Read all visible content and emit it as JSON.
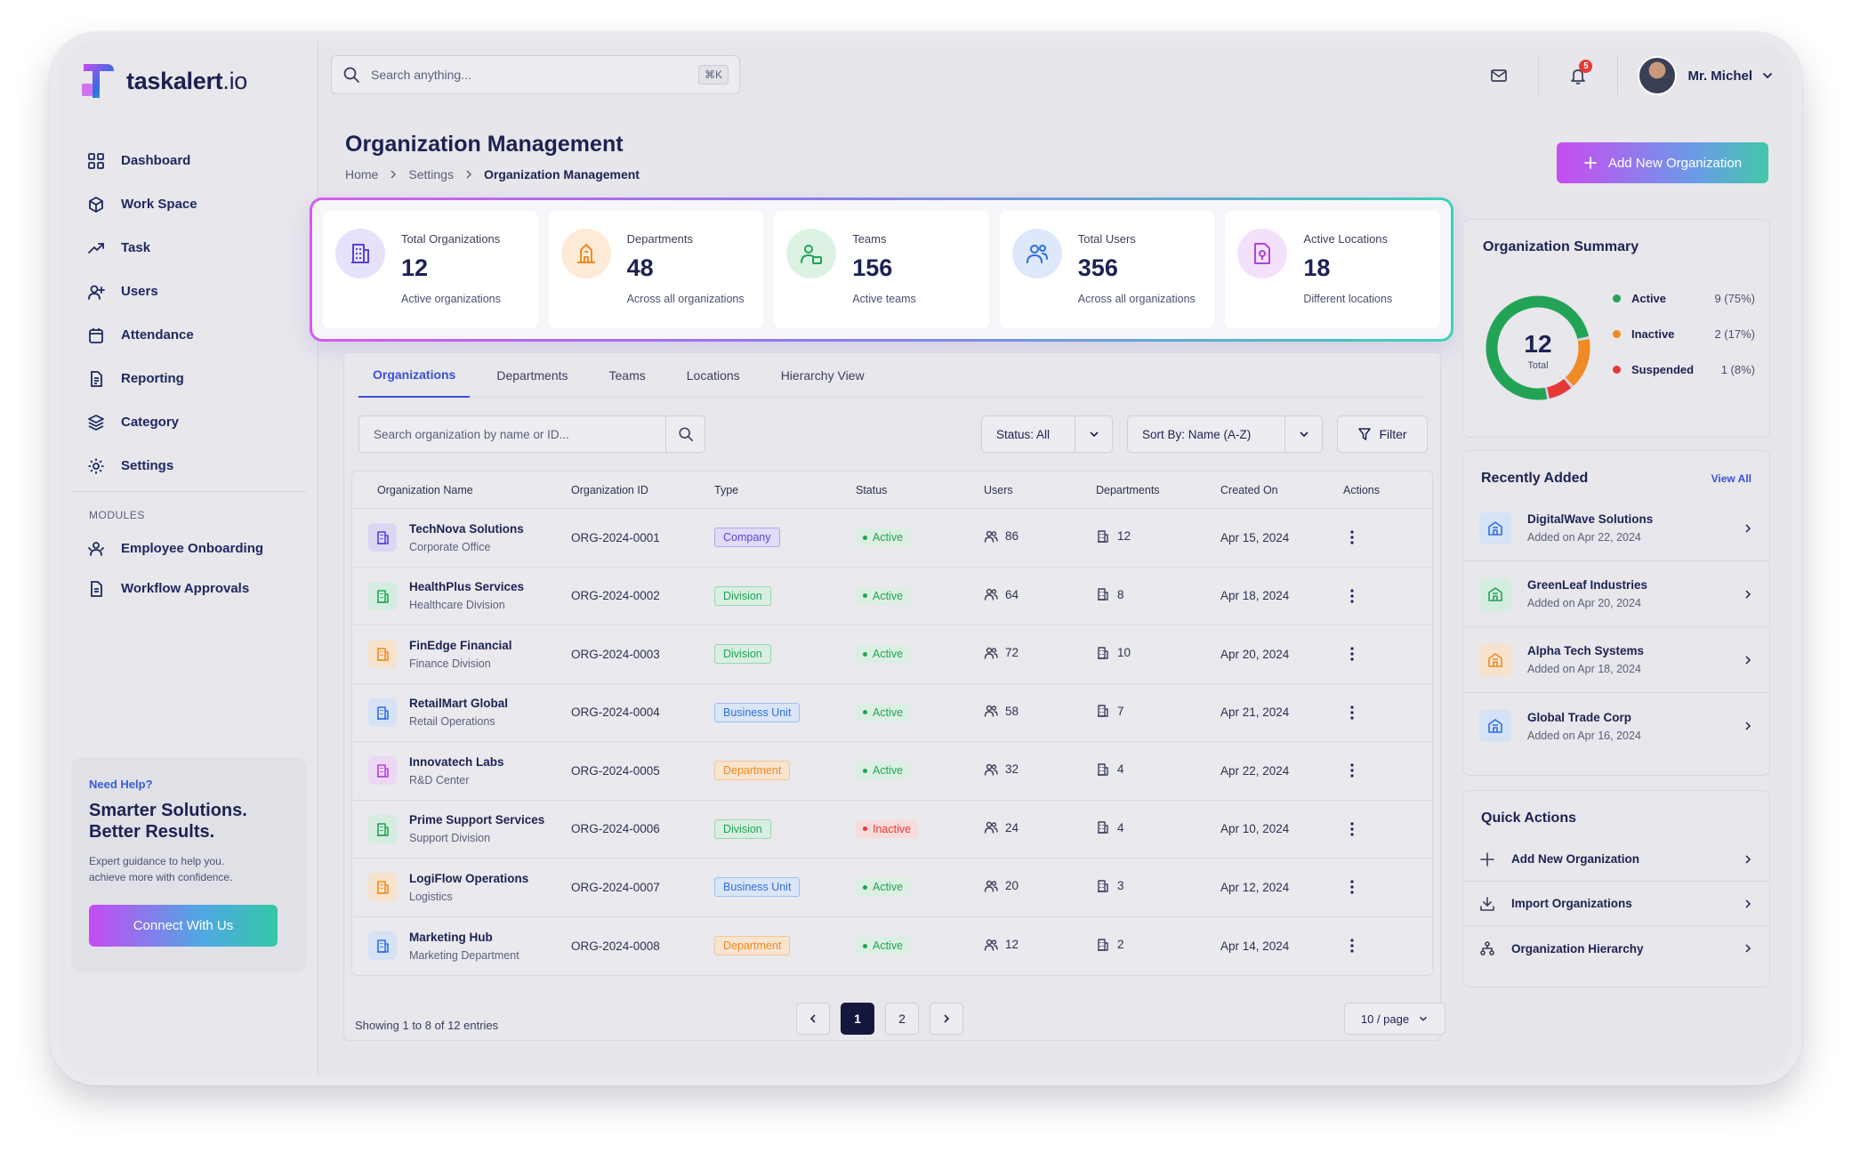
{
  "app": {
    "name": "taskalert",
    "name_suffix": ".io"
  },
  "colors": {
    "accent": "#3b4fd6",
    "active": "#22a355",
    "inactive": "#e53935",
    "suspended": "#e53935",
    "warning": "#f08a24"
  },
  "sidebar": {
    "items": [
      {
        "label": "Dashboard",
        "icon": "grid-icon"
      },
      {
        "label": "Work Space",
        "icon": "cube-icon"
      },
      {
        "label": "Task",
        "icon": "trend-icon"
      },
      {
        "label": "Users",
        "icon": "user-plus-icon"
      },
      {
        "label": "Attendance",
        "icon": "calendar-icon"
      },
      {
        "label": "Reporting",
        "icon": "document-icon"
      },
      {
        "label": "Category",
        "icon": "layers-icon"
      },
      {
        "label": "Settings",
        "icon": "gear-icon"
      }
    ],
    "modules_label": "MODULES",
    "modules": [
      {
        "label": "Employee Onboarding",
        "icon": "user-group-icon"
      },
      {
        "label": "Workflow Approvals",
        "icon": "document-check-icon"
      }
    ],
    "help": {
      "kicker": "Need Help?",
      "title_line1": "Smarter Solutions.",
      "title_line2": "Better Results.",
      "desc_line1": "Expert guidance to help you.",
      "desc_line2": "achieve more with confidence.",
      "button": "Connect With Us"
    }
  },
  "topbar": {
    "search_placeholder": "Search anything...",
    "shortcut": "⌘K",
    "notification_count": "5",
    "user_name": "Mr. Michel"
  },
  "page": {
    "title": "Organization Management",
    "breadcrumb": [
      "Home",
      "Settings",
      "Organization Management"
    ],
    "add_button": "Add New Organization"
  },
  "stats": [
    {
      "label": "Total Organizations",
      "value": "12",
      "sub": "Active organizations",
      "icon": "building-icon",
      "color": "#5b3fd9",
      "bg": "#e7e2fb"
    },
    {
      "label": "Departments",
      "value": "48",
      "sub": "Across all organizations",
      "icon": "department-icon",
      "color": "#f08a24",
      "bg": "#fdebd8"
    },
    {
      "label": "Teams",
      "value": "156",
      "sub": "Active teams",
      "icon": "team-icon",
      "color": "#22a355",
      "bg": "#dcf3e4"
    },
    {
      "label": "Total Users",
      "value": "356",
      "sub": "Across all organizations",
      "icon": "users-icon",
      "color": "#2f6fe0",
      "bg": "#dde8fb"
    },
    {
      "label": "Active Locations",
      "value": "18",
      "sub": "Different locations",
      "icon": "location-icon",
      "color": "#b043e0",
      "bg": "#f3e0fb"
    }
  ],
  "tabs": [
    "Organizations",
    "Departments",
    "Teams",
    "Locations",
    "Hierarchy View"
  ],
  "filters": {
    "search_placeholder": "Search organization by name or ID...",
    "status": "Status: All",
    "sort": "Sort By: Name (A-Z)",
    "filter_label": "Filter"
  },
  "table": {
    "columns": [
      "Organization Name",
      "Organization ID",
      "Type",
      "Status",
      "Users",
      "Departments",
      "Created On",
      "Actions"
    ],
    "rows": [
      {
        "name": "TechNova Solutions",
        "sub": "Corporate Office",
        "id": "ORG-2024-0001",
        "type": "Company",
        "status": "Active",
        "users": "86",
        "departments": "12",
        "created": "Apr 15, 2024",
        "icon_color": "#5b3fd9",
        "icon_bg": "#dcd6f5"
      },
      {
        "name": "HealthPlus Services",
        "sub": "Healthcare Division",
        "id": "ORG-2024-0002",
        "type": "Division",
        "status": "Active",
        "users": "64",
        "departments": "8",
        "created": "Apr 18, 2024",
        "icon_color": "#22a355",
        "icon_bg": "#d4ede0"
      },
      {
        "name": "FinEdge Financial",
        "sub": "Finance Division",
        "id": "ORG-2024-0003",
        "type": "Division",
        "status": "Active",
        "users": "72",
        "departments": "10",
        "created": "Apr 20, 2024",
        "icon_color": "#f08a24",
        "icon_bg": "#f7e2cc"
      },
      {
        "name": "RetailMart Global",
        "sub": "Retail Operations",
        "id": "ORG-2024-0004",
        "type": "Business Unit",
        "status": "Active",
        "users": "58",
        "departments": "7",
        "created": "Apr 21, 2024",
        "icon_color": "#2f6fe0",
        "icon_bg": "#d6e2f6"
      },
      {
        "name": "Innovatech Labs",
        "sub": "R&D Center",
        "id": "ORG-2024-0005",
        "type": "Department",
        "status": "Active",
        "users": "32",
        "departments": "4",
        "created": "Apr 22, 2024",
        "icon_color": "#b043e0",
        "icon_bg": "#ecd8f5"
      },
      {
        "name": "Prime Support Services",
        "sub": "Support Division",
        "id": "ORG-2024-0006",
        "type": "Division",
        "status": "Inactive",
        "users": "24",
        "departments": "4",
        "created": "Apr 10, 2024",
        "icon_color": "#22a355",
        "icon_bg": "#d4ede0"
      },
      {
        "name": "LogiFlow Operations",
        "sub": "Logistics",
        "id": "ORG-2024-0007",
        "type": "Business Unit",
        "status": "Active",
        "users": "20",
        "departments": "3",
        "created": "Apr 12, 2024",
        "icon_color": "#f08a24",
        "icon_bg": "#f7e2cc"
      },
      {
        "name": "Marketing Hub",
        "sub": "Marketing Department",
        "id": "ORG-2024-0008",
        "type": "Department",
        "status": "Active",
        "users": "12",
        "departments": "2",
        "created": "Apr 14, 2024",
        "icon_color": "#2f6fe0",
        "icon_bg": "#d6e2f6"
      }
    ]
  },
  "pagination": {
    "info": "Showing 1 to 8 of 12 entries",
    "pages": [
      "1",
      "2"
    ],
    "current": "1",
    "per_page": "10 / page"
  },
  "summary": {
    "title": "Organization Summary",
    "total_value": "12",
    "total_label": "Total",
    "segments": [
      {
        "name": "Active",
        "label": "9 (75%)",
        "value": 9,
        "color": "#22a355"
      },
      {
        "name": "Inactive",
        "label": "2 (17%)",
        "value": 2,
        "color": "#f08a24"
      },
      {
        "name": "Suspended",
        "label": "1 (8%)",
        "value": 1,
        "color": "#e53935"
      }
    ]
  },
  "recent": {
    "title": "Recently Added",
    "view_all": "View All",
    "items": [
      {
        "name": "DigitalWave Solutions",
        "sub": "Added on Apr 22, 2024",
        "color": "#2f6fe0",
        "bg": "#d6e2f6"
      },
      {
        "name": "GreenLeaf Industries",
        "sub": "Added on Apr 20, 2024",
        "color": "#22a355",
        "bg": "#d4ede0"
      },
      {
        "name": "Alpha Tech Systems",
        "sub": "Added on Apr 18, 2024",
        "color": "#f08a24",
        "bg": "#f7e2cc"
      },
      {
        "name": "Global Trade Corp",
        "sub": "Added on Apr 16, 2024",
        "color": "#2f6fe0",
        "bg": "#d6e2f6"
      }
    ]
  },
  "quick_actions": {
    "title": "Quick Actions",
    "items": [
      {
        "label": "Add New Organization",
        "icon": "plus-icon"
      },
      {
        "label": "Import Organizations",
        "icon": "import-icon"
      },
      {
        "label": "Organization Hierarchy",
        "icon": "hierarchy-icon"
      }
    ]
  }
}
